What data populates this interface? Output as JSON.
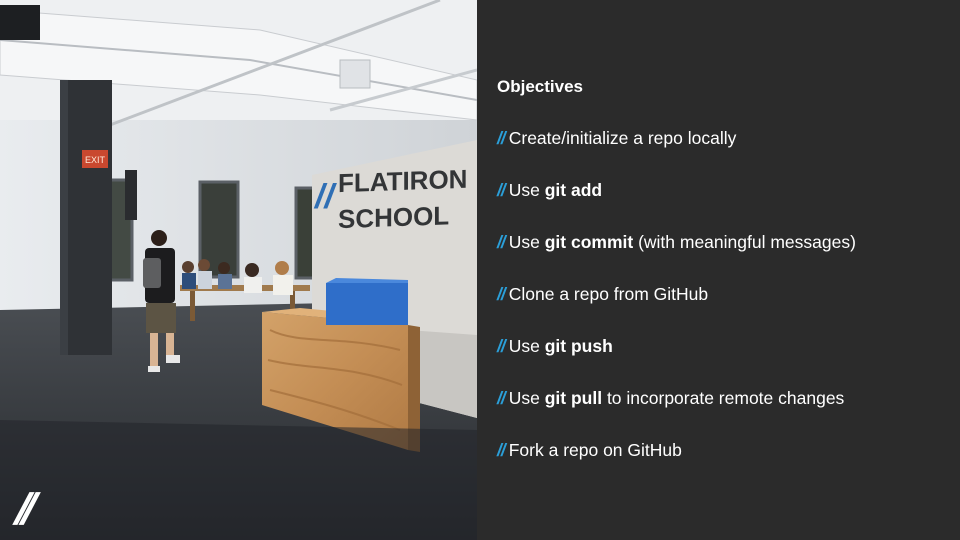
{
  "photo": {
    "sign_line1": "FLATIRON",
    "sign_line2": "SCHOOL",
    "sign_slashes": "//",
    "exit_sign": "EXIT"
  },
  "brand_logo": "//",
  "heading": "Objectives",
  "bullet_marker": "//",
  "accent_color": "#2b9fd9",
  "background_color": "#2b2b2b",
  "objectives": [
    {
      "pre": "Create/initialize a repo locally",
      "bold": "",
      "post": ""
    },
    {
      "pre": "Use ",
      "bold": "git add",
      "post": ""
    },
    {
      "pre": "Use ",
      "bold": "git commit",
      "post": " (with meaningful messages)"
    },
    {
      "pre": "Clone a repo from GitHub",
      "bold": "",
      "post": ""
    },
    {
      "pre": "Use ",
      "bold": "git push",
      "post": ""
    },
    {
      "pre": "Use ",
      "bold": "git pull",
      "post": " to incorporate remote changes"
    },
    {
      "pre": "Fork a repo on GitHub",
      "bold": "",
      "post": ""
    }
  ]
}
